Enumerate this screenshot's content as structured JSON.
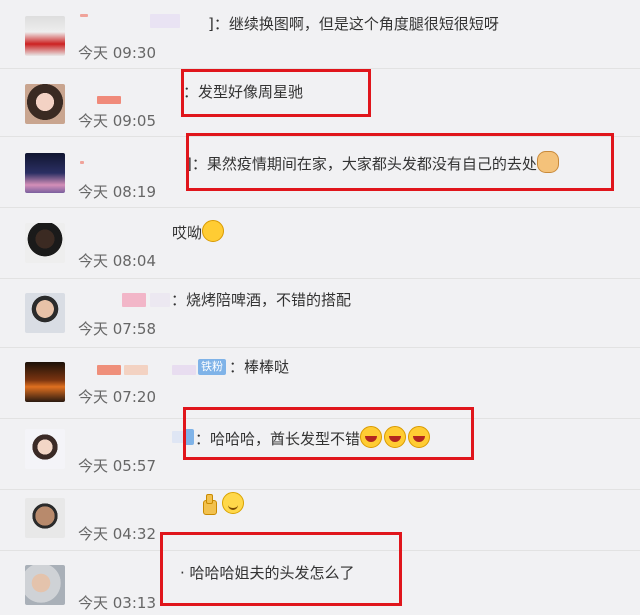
{
  "comments": [
    {
      "text": "]：继续换图啊，但是这个角度腿很短很短呀",
      "time": "今天 09:30"
    },
    {
      "text": "：发型好像周星驰",
      "time": "今天 09:05"
    },
    {
      "text": "]：果然疫情期间在家，大家都头发都没有自己的去处",
      "time": "今天 08:19"
    },
    {
      "text": "哎呦",
      "time": "今天 08:04"
    },
    {
      "text": "：烧烤陪啤酒，不错的搭配",
      "time": "今天 07:58"
    },
    {
      "text": "：棒棒哒",
      "time": "今天 07:20",
      "badge": "铁粉"
    },
    {
      "text": "：哈哈哈，酋长发型不错",
      "time": "今天 05:57"
    },
    {
      "text": "",
      "time": "今天 04:32"
    },
    {
      "text": "·  哈哈哈姐夫的头发怎么了",
      "time": "今天 03:13"
    }
  ],
  "icons": {
    "sweat": "sweat-smile-emoji",
    "cat": "cat-emoji",
    "laugh": "laughing-emoji",
    "thumb": "thumbs-up-emoji",
    "smile": "smile-emoji"
  },
  "colors": {
    "highlight_box": "#e0151b",
    "badge": "#7fb3e8",
    "background": "#f1f1f3"
  }
}
